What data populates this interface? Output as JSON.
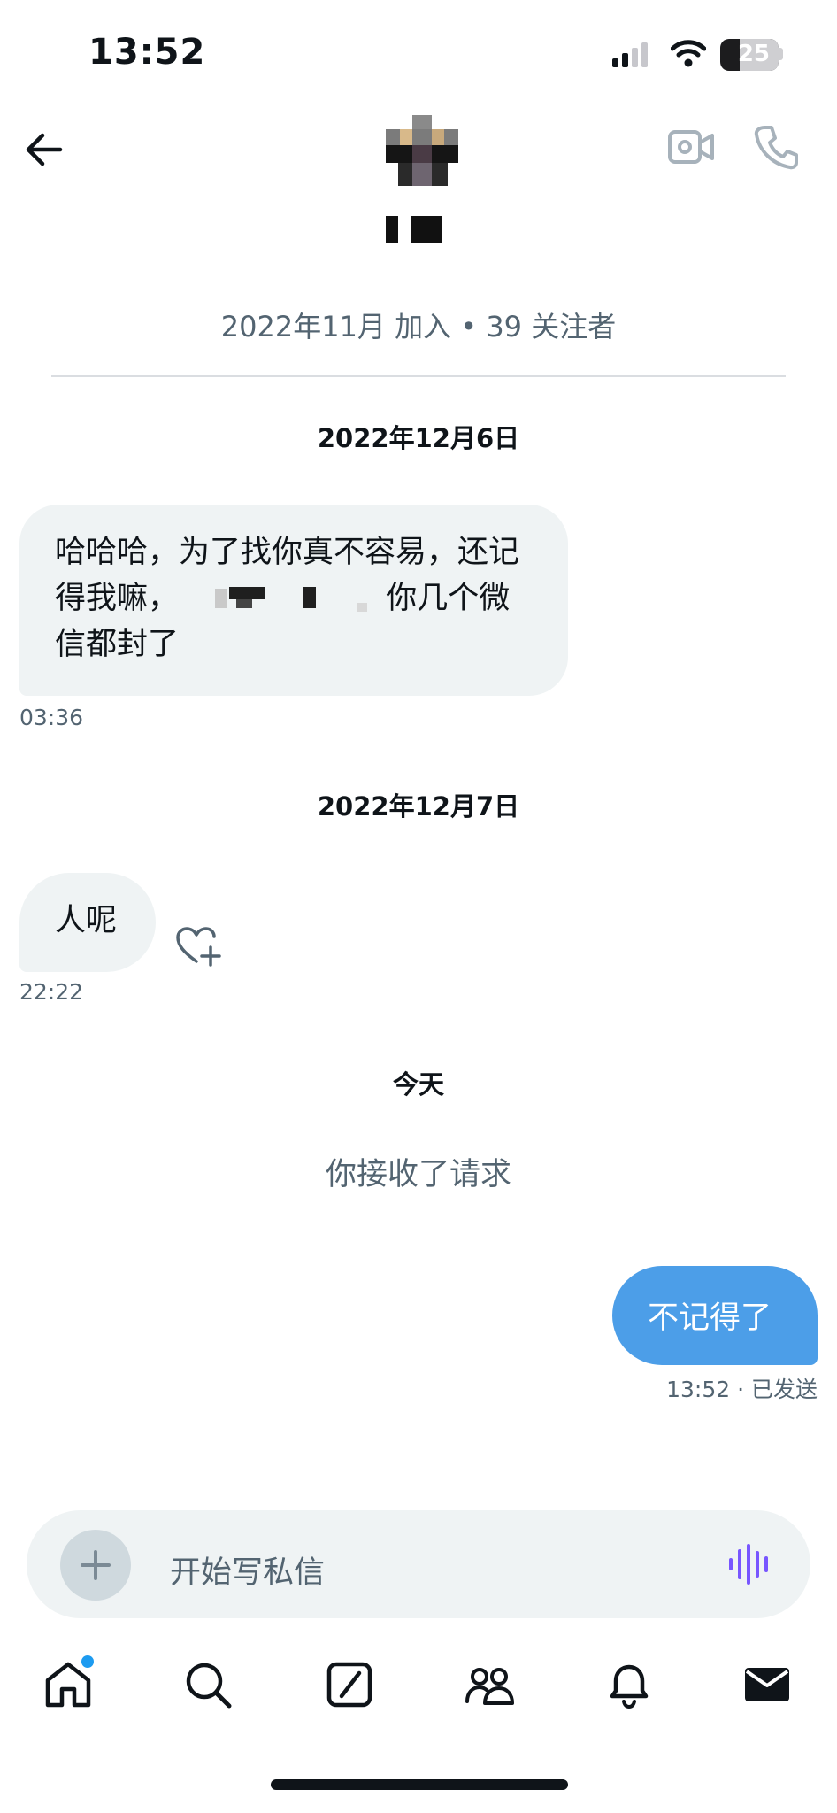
{
  "status_bar": {
    "time": "13:52",
    "battery": "25"
  },
  "header": {
    "joined_info": "2022年11月 加入 • 39 关注者",
    "back_icon": "arrow-left-icon",
    "video_icon": "video-call-icon",
    "phone_icon": "phone-icon"
  },
  "messages": {
    "date_1": "2022年12月6日",
    "msg_1_part1": "哈哈哈，为了找你真不容易，还记得我嘛，",
    "msg_1_part2": "你几个微信都封了",
    "msg_1_time": "03:36",
    "date_2": "2022年12月7日",
    "msg_2": "人呢",
    "msg_2_time": "22:22",
    "date_3": "今天",
    "system_note": "你接收了请求",
    "msg_3": "不记得了",
    "msg_3_status": "13:52 · 已发送"
  },
  "composer": {
    "placeholder": "开始写私信"
  },
  "tab_bar": {
    "items": [
      "home-icon",
      "search-icon",
      "compose-icon",
      "communities-icon",
      "notifications-icon",
      "messages-icon"
    ]
  },
  "colors": {
    "accent": "#1d9bf0",
    "outgoing_bubble": "#4c9ee8",
    "incoming_bubble": "#eff3f4",
    "muted_text": "#536471"
  }
}
